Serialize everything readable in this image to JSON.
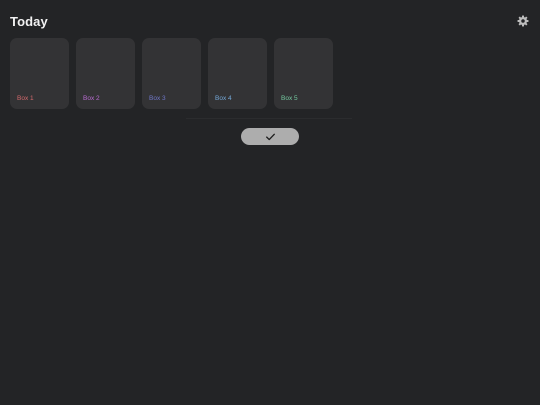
{
  "header": {
    "title": "Today",
    "settings_icon": "gear-icon"
  },
  "boxes": [
    {
      "label": "Box 1",
      "color": "#d3696c"
    },
    {
      "label": "Box 2",
      "color": "#b86bd0"
    },
    {
      "label": "Box 3",
      "color": "#6f77c8"
    },
    {
      "label": "Box 4",
      "color": "#74a8d8"
    },
    {
      "label": "Box 5",
      "color": "#74c9a0"
    }
  ],
  "confirm": {
    "icon": "checkmark-icon"
  }
}
